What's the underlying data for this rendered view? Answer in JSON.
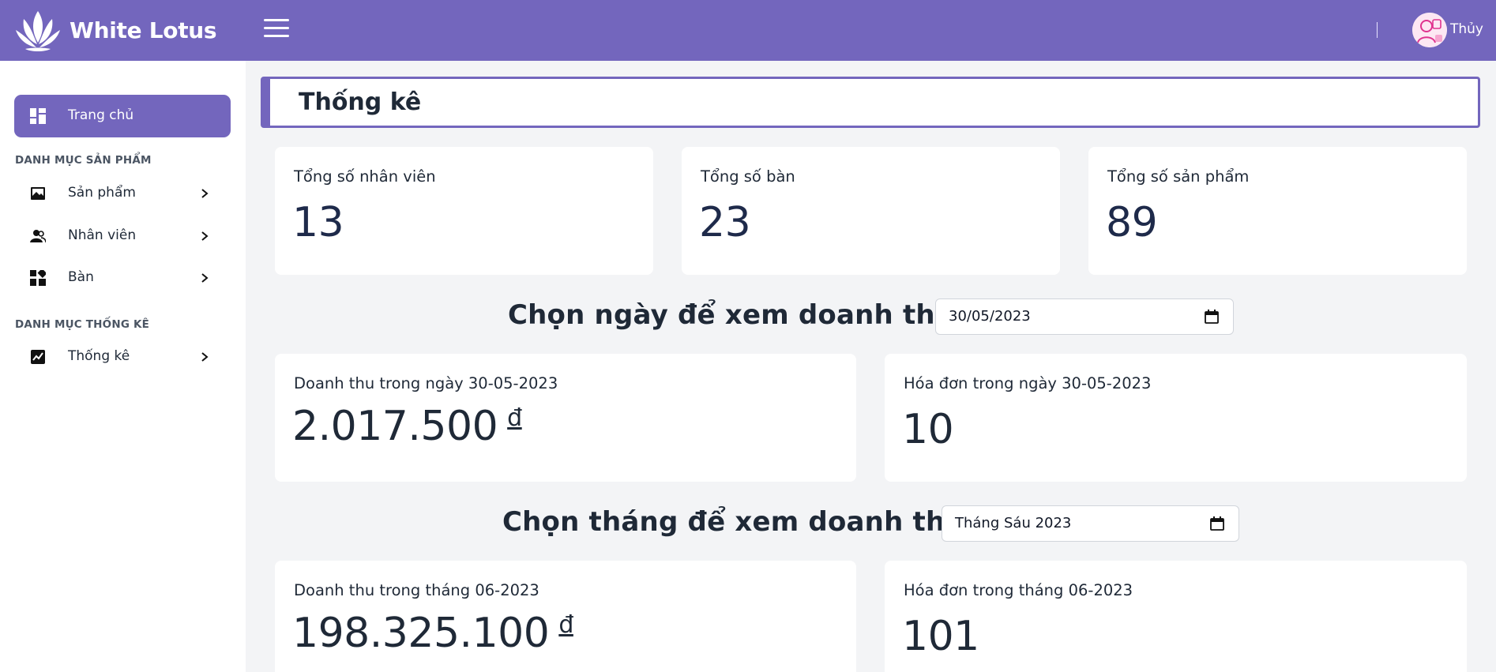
{
  "header": {
    "brand": "White Lotus",
    "user_name": "Thủy",
    "brand_color": "#7366bd"
  },
  "sidebar": {
    "home_label": "Trang chủ",
    "section_products": "DANH MỤC SẢN PHẨM",
    "items": [
      {
        "label": "Sản phẩm",
        "icon": "image-icon"
      },
      {
        "label": "Nhân viên",
        "icon": "users-icon"
      },
      {
        "label": "Bàn",
        "icon": "grid-icon"
      }
    ],
    "section_stats": "DANH MỤC THỐNG KÊ",
    "stats_item": {
      "label": "Thống kê",
      "icon": "chart-icon"
    }
  },
  "main": {
    "title": "Thống kê",
    "summary": [
      {
        "caption": "Tổng số nhân viên",
        "value": "13"
      },
      {
        "caption": "Tổng số bàn",
        "value": "23"
      },
      {
        "caption": "Tổng số sản phẩm",
        "value": "89"
      }
    ],
    "day": {
      "label": "Chọn ngày để xem doanh thu:",
      "picker_value": "30/05/2023",
      "revenue_caption": "Doanh thu trong ngày 30-05-2023",
      "revenue_value": "2.017.500",
      "currency": "đ",
      "invoice_caption": "Hóa đơn trong ngày 30-05-2023",
      "invoice_value": "10"
    },
    "month": {
      "label": "Chọn tháng để xem doanh thu:",
      "picker_value": "Tháng Sáu 2023",
      "revenue_caption": "Doanh thu trong tháng 06-2023",
      "revenue_value": "198.325.100",
      "currency": "đ",
      "invoice_caption": "Hóa đơn trong tháng 06-2023",
      "invoice_value": "101"
    }
  }
}
